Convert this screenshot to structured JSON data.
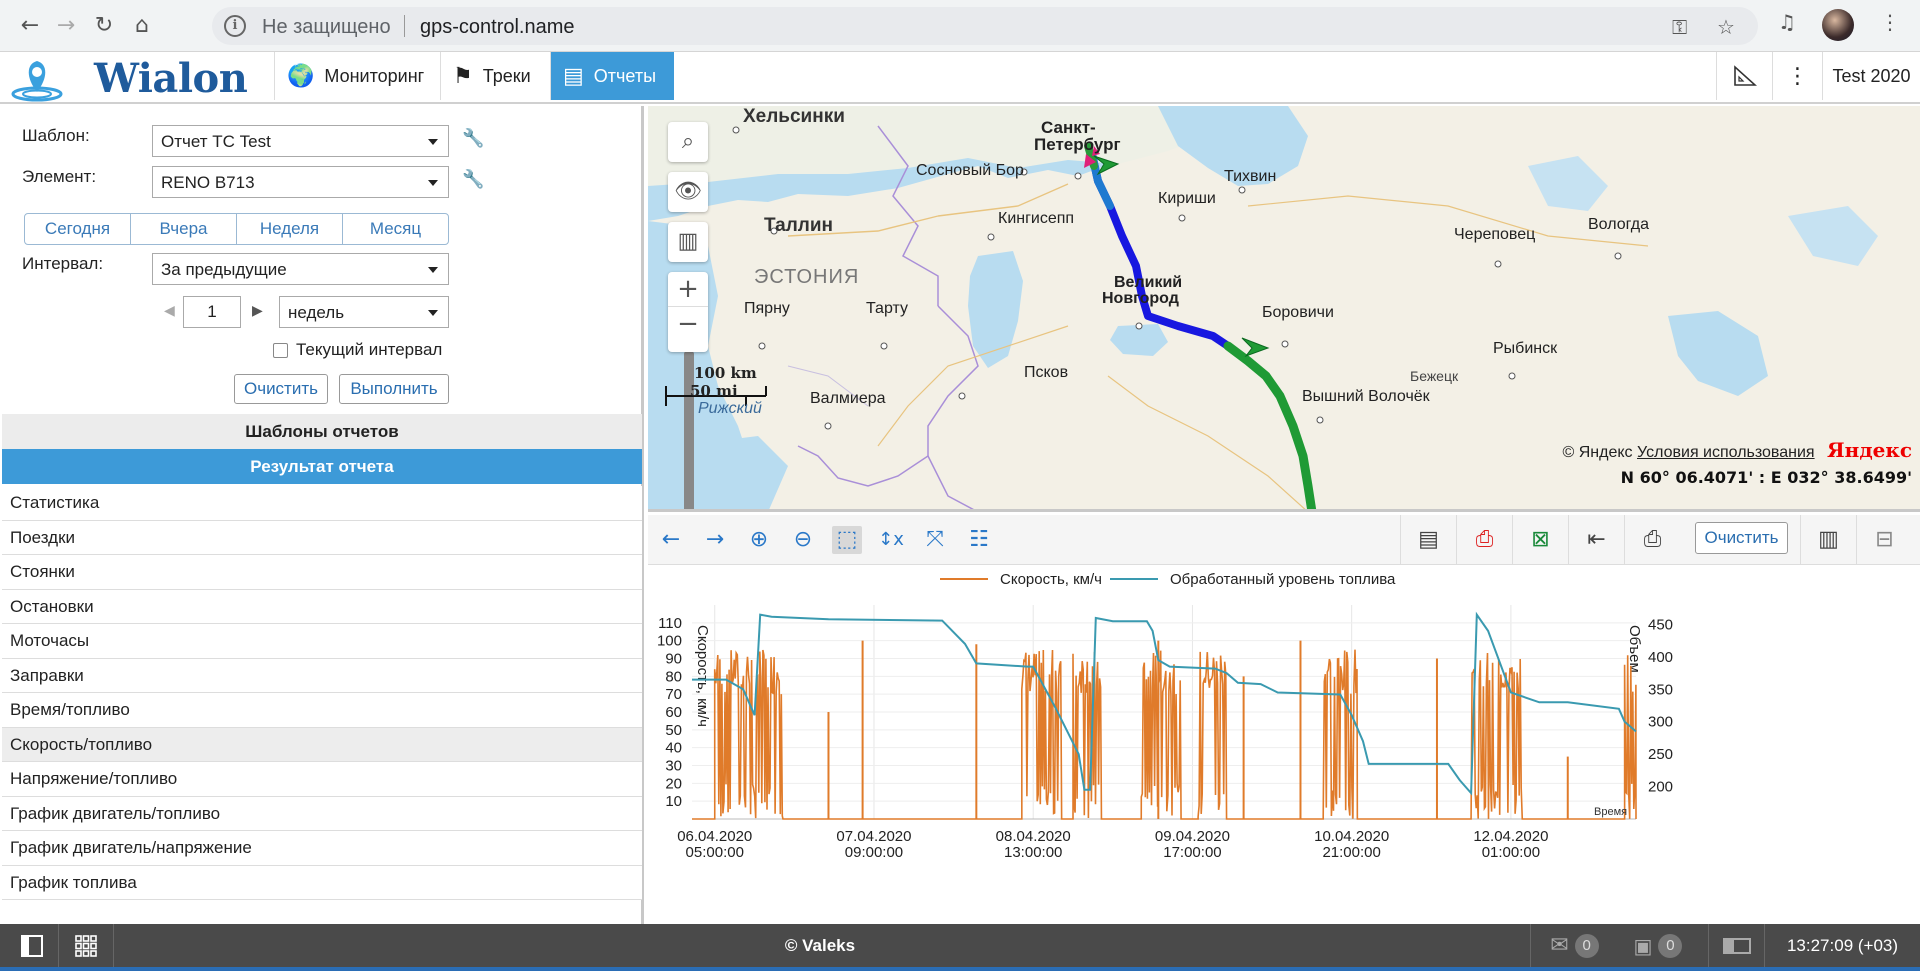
{
  "browser": {
    "insecure_label": "Не защищено",
    "url": "gps-control.name"
  },
  "app": {
    "logo_text": "Wialon",
    "menu": [
      {
        "label": "Мониторинг",
        "icon": "globe-icon"
      },
      {
        "label": "Треки",
        "icon": "checkered-flag-icon"
      },
      {
        "label": "Отчеты",
        "icon": "report-icon",
        "active": true
      }
    ],
    "user": "Test 2020"
  },
  "report_form": {
    "template_label": "Шаблон:",
    "template_value": "Отчет ТС Test",
    "element_label": "Элемент:",
    "element_value": "RENO B713",
    "periods": [
      "Сегодня",
      "Вчера",
      "Неделя",
      "Месяц"
    ],
    "interval_label": "Интервал:",
    "interval_value": "За предыдущие",
    "count_value": "1",
    "unit_value": "недель",
    "current_interval_label": "Текущий интервал",
    "clear_label": "Очистить",
    "execute_label": "Выполнить"
  },
  "sections": {
    "templates": "Шаблоны отчетов",
    "result": "Результат отчета"
  },
  "report_items": [
    "Статистика",
    "Поездки",
    "Стоянки",
    "Остановки",
    "Моточасы",
    "Заправки",
    "Время/топливо",
    "Скорость/топливо",
    "Напряжение/топливо",
    "График двигатель/топливо",
    "График двигатель/напряжение",
    "График топлива"
  ],
  "selected_report_index": 7,
  "map": {
    "labels": {
      "helsinki": "Хельсинки",
      "spb1": "Санкт-",
      "spb2": "Петербург",
      "sosnovy_bor": "Сосновый Бор",
      "tikhvin": "Тихвин",
      "kirishi": "Кириши",
      "tallinn": "Таллин",
      "kingisepp": "Кингисепп",
      "cherepovets": "Череповец",
      "vologda": "Вологда",
      "estonia": "ЭСТОНИЯ",
      "vnovgorod1": "Великий",
      "vnovgorod2": "Новгород",
      "borovichi": "Боровичи",
      "parnu": "Пярну",
      "tartu": "Тарту",
      "rybinsk": "Рыбинск",
      "pskov": "Псков",
      "valmiera": "Валмиера",
      "vyshny": "Вышний Волочёк",
      "rizhsky": "Рижский",
      "bezhetsk": "Бежецк"
    },
    "scale_km": "100 km",
    "scale_mi": "50 mi",
    "attribution_prefix": "© Яндекс",
    "attribution_link": "Условия использования",
    "yandex": "Яндекс",
    "coords": "N 60° 06.4071' : E 032° 38.6499'"
  },
  "chart_toolbar": {
    "clear_label": "Очистить"
  },
  "chart_data": {
    "type": "line",
    "series": [
      {
        "name": "Скорость, км/ч",
        "color": "#e07b2a"
      },
      {
        "name": "Обработанный уровень топлива",
        "color": "#3a9ab0"
      }
    ],
    "ylabel_left": "Скорость, км/ч",
    "ylabel_right": "Объем",
    "yticks_left": [
      10,
      20,
      30,
      40,
      50,
      60,
      70,
      80,
      90,
      100,
      110
    ],
    "yticks_right": [
      200,
      250,
      300,
      350,
      400,
      450
    ],
    "ylim_left": [
      0,
      120
    ],
    "ylim_right": [
      150,
      480
    ],
    "xticks": [
      {
        "line1": "06.04.2020",
        "line2": "05:00:00",
        "t": 0
      },
      {
        "line1": "07.04.2020",
        "line2": "09:00:00",
        "t": 28
      },
      {
        "line1": "08.04.2020",
        "line2": "13:00:00",
        "t": 56
      },
      {
        "line1": "09.04.2020",
        "line2": "17:00:00",
        "t": 84
      },
      {
        "line1": "10.04.2020",
        "line2": "21:00:00",
        "t": 112
      },
      {
        "line1": "12.04.2020",
        "line2": "01:00:00",
        "t": 140
      }
    ],
    "xlim": [
      -4,
      162
    ],
    "fuel": [
      [
        -4,
        365
      ],
      [
        2,
        365
      ],
      [
        5,
        350
      ],
      [
        7,
        310
      ],
      [
        8,
        465
      ],
      [
        10,
        462
      ],
      [
        20,
        458
      ],
      [
        40,
        456
      ],
      [
        44,
        420
      ],
      [
        46,
        390
      ],
      [
        55,
        385
      ],
      [
        56,
        385
      ],
      [
        60,
        320
      ],
      [
        64,
        250
      ],
      [
        65,
        195
      ],
      [
        66,
        195
      ],
      [
        67,
        460
      ],
      [
        70,
        455
      ],
      [
        76,
        455
      ],
      [
        77,
        440
      ],
      [
        78,
        395
      ],
      [
        80,
        385
      ],
      [
        88,
        382
      ],
      [
        90,
        375
      ],
      [
        92,
        360
      ],
      [
        96,
        358
      ],
      [
        99,
        345
      ],
      [
        110,
        342
      ],
      [
        112,
        310
      ],
      [
        114,
        270
      ],
      [
        115,
        235
      ],
      [
        129,
        235
      ],
      [
        131,
        210
      ],
      [
        133,
        190
      ],
      [
        134,
        465
      ],
      [
        136,
        440
      ],
      [
        140,
        345
      ],
      [
        145,
        330
      ],
      [
        150,
        330
      ],
      [
        159,
        320
      ],
      [
        160,
        300
      ],
      [
        162,
        285
      ]
    ],
    "speed_bursts": [
      [
        0,
        12
      ],
      [
        54,
        61
      ],
      [
        63,
        68
      ],
      [
        75,
        82
      ],
      [
        85,
        90
      ],
      [
        107,
        113
      ],
      [
        133,
        142
      ],
      [
        160,
        162
      ]
    ],
    "speed_spikes": [
      [
        20,
        60
      ],
      [
        26,
        100
      ],
      [
        46,
        98
      ],
      [
        78,
        100
      ],
      [
        93,
        80
      ],
      [
        103,
        100
      ],
      [
        127,
        90
      ],
      [
        150,
        35
      ]
    ],
    "speed_notch": "Время"
  },
  "bottom_bar": {
    "copyright": "© Valeks",
    "messages_count": "0",
    "images_count": "0",
    "time": "13:27:09 (+03)"
  }
}
